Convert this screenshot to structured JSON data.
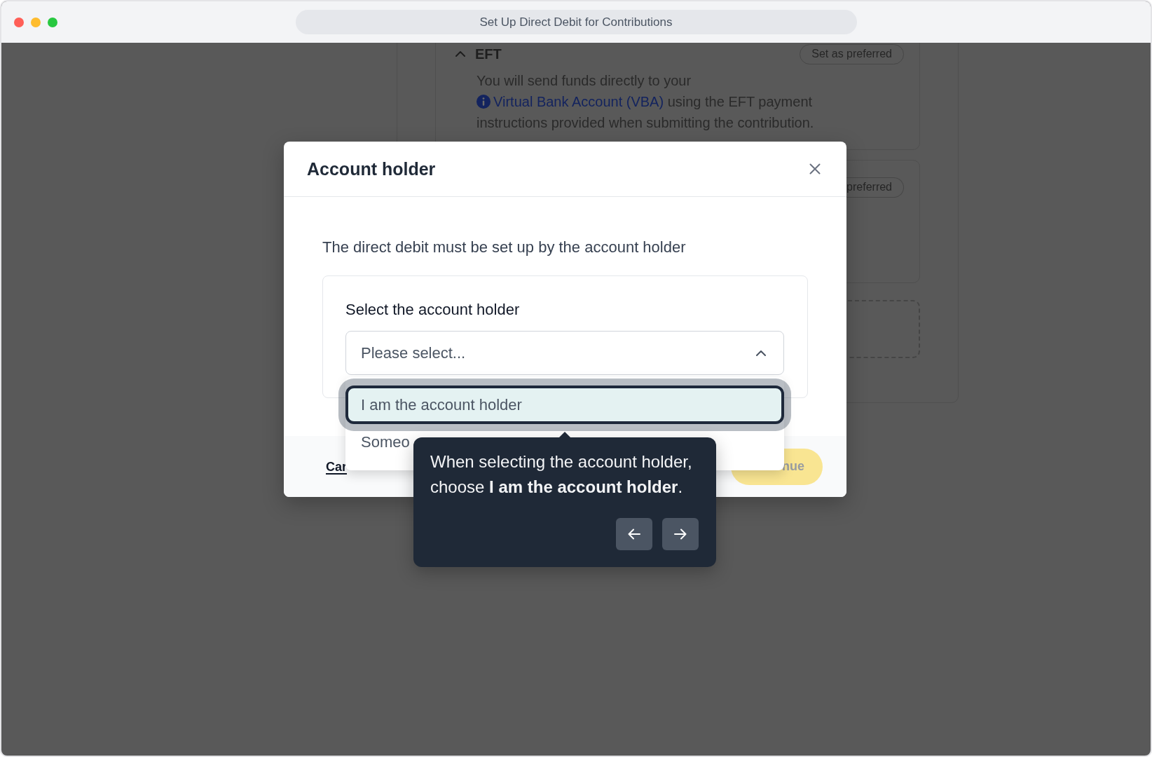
{
  "window": {
    "title": "Set Up Direct Debit for Contributions"
  },
  "payment_methods": [
    {
      "kind": "method",
      "title": "EFT",
      "expanded": true,
      "preferred_label": "Set as preferred",
      "description": "You will send funds directly to your",
      "link": "Virtual Bank Account (VBA)",
      "description_after": "using the EFT payment instructions provided when submitting the contribution."
    },
    {
      "kind": "method",
      "preferred_label": "preferred"
    },
    {
      "kind": "dashed"
    }
  ],
  "dialog": {
    "title": "Account holder",
    "intro": "The direct debit must be set up by the account holder",
    "field": {
      "label": "Select the account holder",
      "placeholder": "Please select...",
      "expanded": true,
      "options": [
        {
          "label": "I am the account holder",
          "highlighted": true
        },
        {
          "label": "Someo",
          "highlighted": false
        }
      ]
    },
    "footer": {
      "cancel": "Car",
      "continue": {
        "label": "nue",
        "disabled": true
      }
    }
  },
  "tour_tooltip": {
    "text": "When selecting the account holder, choose **I am the account holder**."
  }
}
